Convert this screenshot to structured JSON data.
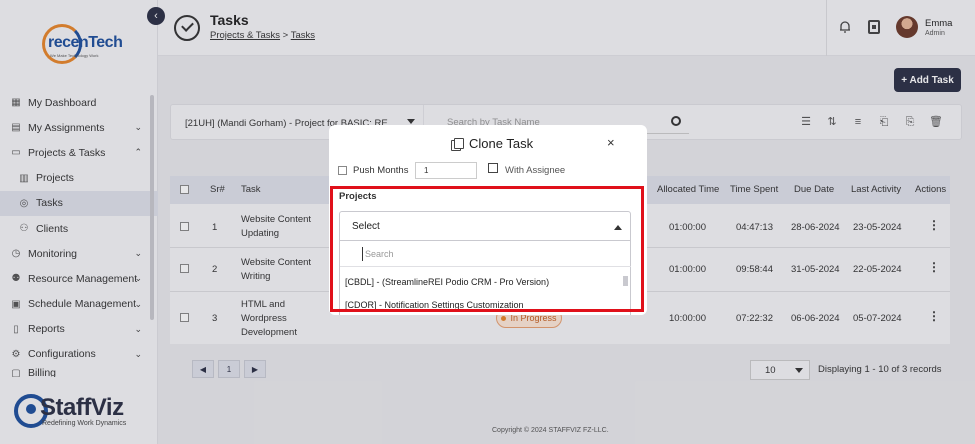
{
  "sidebar": {
    "logo_text": "recenTech",
    "logo_tagline": "We Make Technology Work",
    "items": [
      {
        "label": "My Dashboard",
        "icon": "dashboard-icon"
      },
      {
        "label": "My Assignments",
        "icon": "assignments-icon"
      },
      {
        "label": "Projects & Tasks",
        "icon": "folder-icon"
      },
      {
        "label": "Projects",
        "icon": "projects-icon"
      },
      {
        "label": "Tasks",
        "icon": "check-circle-icon"
      },
      {
        "label": "Clients",
        "icon": "clients-icon"
      },
      {
        "label": "Monitoring",
        "icon": "monitoring-icon"
      },
      {
        "label": "Resource Management",
        "icon": "resources-icon"
      },
      {
        "label": "Schedule Management",
        "icon": "schedule-icon"
      },
      {
        "label": "Reports",
        "icon": "reports-icon"
      },
      {
        "label": "Configurations",
        "icon": "gear-icon"
      },
      {
        "label": "Billing",
        "icon": "billing-icon"
      }
    ],
    "brand_name": "StaffViz",
    "brand_tagline": "Redefining Work Dynamics"
  },
  "header": {
    "title": "Tasks",
    "breadcrumb_parent": "Projects & Tasks",
    "breadcrumb_sep": " > ",
    "breadcrumb_current": "Tasks",
    "user_name": "Emma",
    "user_role": "Admin"
  },
  "toolbar": {
    "add_task": "+ Add Task",
    "project_filter": "[21UH] (Mandi Gorham) - Project for BASIC: RE...",
    "search_placeholder": "Search by Task Name"
  },
  "table": {
    "columns": [
      "Sr#",
      "Task",
      "Allocated Time",
      "Time Spent",
      "Due Date",
      "Last Activity",
      "Actions"
    ],
    "rows": [
      {
        "sr": "1",
        "task_l1": "Website Content",
        "task_l2": "Updating",
        "task_l3": "",
        "allocated": "01:00:00",
        "spent": "04:47:13",
        "due": "28-06-2024",
        "last": "23-05-2024"
      },
      {
        "sr": "2",
        "task_l1": "Website Content",
        "task_l2": "Writing",
        "task_l3": "",
        "allocated": "01:00:00",
        "spent": "09:58:44",
        "due": "31-05-2024",
        "last": "22-05-2024"
      },
      {
        "sr": "3",
        "task_l1": "HTML and",
        "task_l2": "Wordpress",
        "task_l3": "Development",
        "allocated": "10:00:00",
        "spent": "07:22:32",
        "due": "06-06-2024",
        "last": "05-07-2024",
        "status": "In Progress"
      }
    ]
  },
  "pager": {
    "prev": "◀",
    "page": "1",
    "next": "▶",
    "per_page": "10",
    "records": "Displaying 1 - 10 of 3 records"
  },
  "footer": {
    "copyright": "Copyright © 2024 STAFFVIZ FZ-LLC."
  },
  "modal": {
    "title": "Clone Task",
    "close": "×",
    "push_months_label": "Push Months",
    "push_months_value": "1",
    "with_assignee_label": "With Assignee",
    "projects_label": "Projects",
    "select_value": "Select",
    "search_placeholder": "Search",
    "options": [
      "[CBDL] - (StreamlineREI Podio CRM - Pro Version)",
      "[CDOR] - Notification Settings Customization"
    ],
    "highlight_color": "#e0101a"
  }
}
